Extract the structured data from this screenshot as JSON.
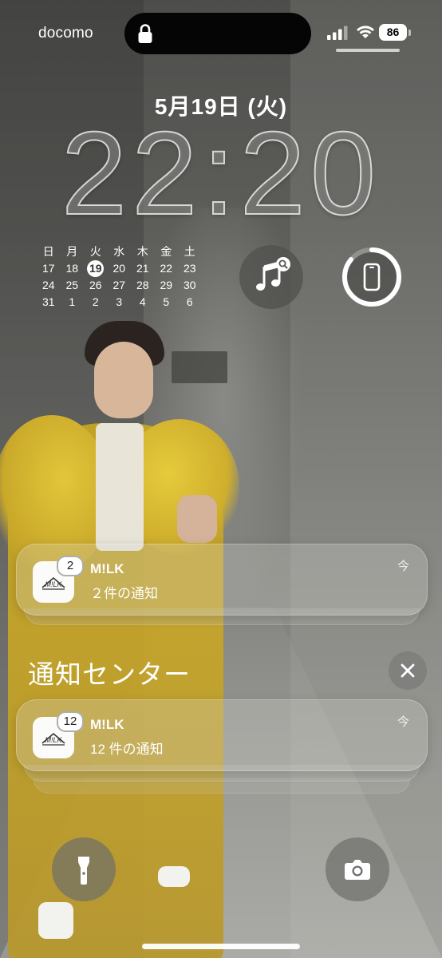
{
  "status_bar": {
    "carrier": "docomo",
    "battery_level": "86"
  },
  "lock_screen": {
    "date": "5月19日 (火)",
    "time": "22:20"
  },
  "calendar": {
    "weekdays": [
      "日",
      "月",
      "火",
      "水",
      "木",
      "金",
      "土"
    ],
    "weeks": [
      [
        "17",
        "18",
        "19",
        "20",
        "21",
        "22",
        "23"
      ],
      [
        "24",
        "25",
        "26",
        "27",
        "28",
        "29",
        "30"
      ],
      [
        "31",
        "1",
        "2",
        "3",
        "4",
        "5",
        "6"
      ]
    ],
    "today": "19"
  },
  "widgets": {
    "music_icon": "music-search-icon",
    "device_icon": "iphone-battery-ring-icon"
  },
  "notifications": [
    {
      "app": "M!LK",
      "body": "２件の通知",
      "time": "今",
      "badge": "2"
    }
  ],
  "notification_center": {
    "title": "通知センター",
    "items": [
      {
        "app": "M!LK",
        "body": "12 件の通知",
        "time": "今",
        "badge": "12"
      }
    ]
  },
  "colors": {
    "accent": "#ffffff",
    "coat_yellow": "#c9a81f"
  }
}
